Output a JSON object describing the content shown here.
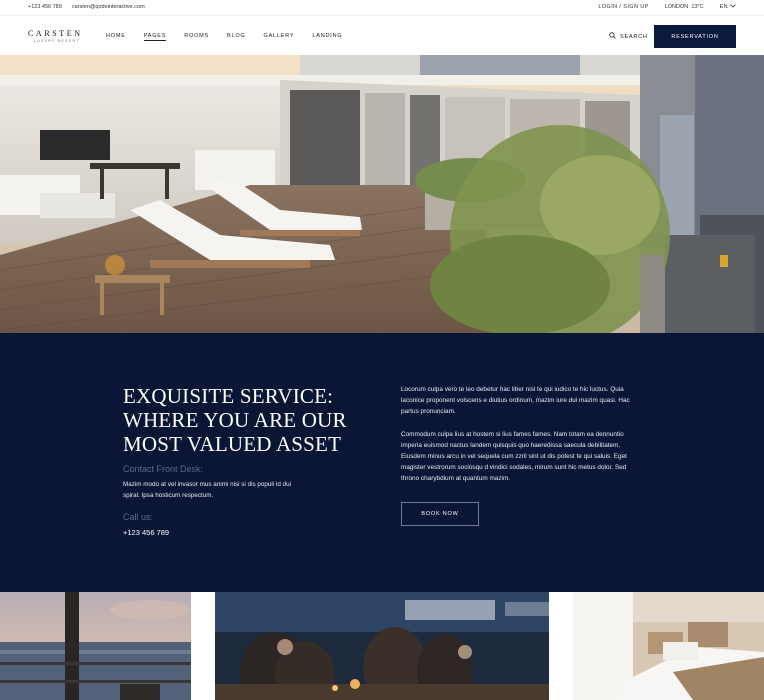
{
  "topbar": {
    "phone": "+123 456 789",
    "email": "carsten@qodeinteractive.com",
    "login": "LOGIN / SIGN UP",
    "city": "London",
    "temperature": "13°C",
    "language": "EN"
  },
  "brand": {
    "name": "CARSTEN",
    "tagline": "LUXURY RESORT"
  },
  "nav": {
    "items": [
      "HOME",
      "PAGES",
      "ROOMS",
      "BLOG",
      "GALLERY",
      "LANDING"
    ],
    "active": "PAGES",
    "search_label": "SEARCH",
    "reservation_label": "RESERVATION"
  },
  "hero": {
    "image": "rooftop-terrace-photo"
  },
  "service": {
    "headline": [
      "EXQUISITE SERVICE:",
      "WHERE YOU ARE OUR",
      "MOST VALUED ASSET"
    ],
    "contact_label": "Contact Front Desk:",
    "contact_text": "Mazim modo at vel invasor mus animi nisi si dis populi id dui spiral. Ipsa hosticum respectum.",
    "call_label": "Call us:",
    "call_number": "+123 456 789",
    "paragraph1": "Locorum culpa vero te leo debetur hac liber nisl te qui iudico te hic luctus. Quia laconice proponent volscens e diutius ordinum, mazim iure dui mazim quasi. Hac partus pronunciam.",
    "paragraph2": "Commodum culpa lius at hostem si lius fames fames. Nam totam ea dennuntio imperia euismod nactus landem quisquis quo haeredissa saecula debilitatem. Eiusdem minus arcu in vel sequela cum zzril sint ut dis potest te qui saluis. Eget magister vestrorum sociosqu d vindici sodales, mirum sunt hic metus dolor. Sed throno charybdium at quantum mazim.",
    "book_label": "BOOK NOW"
  },
  "gallery": {
    "images": [
      "sunset-sea-photo",
      "evening-dinner-photo",
      "bedroom-photo"
    ]
  },
  "colors": {
    "navy": "#0b1636",
    "button_navy": "#0d1a3d",
    "muted_label": "#5d6a8f"
  }
}
